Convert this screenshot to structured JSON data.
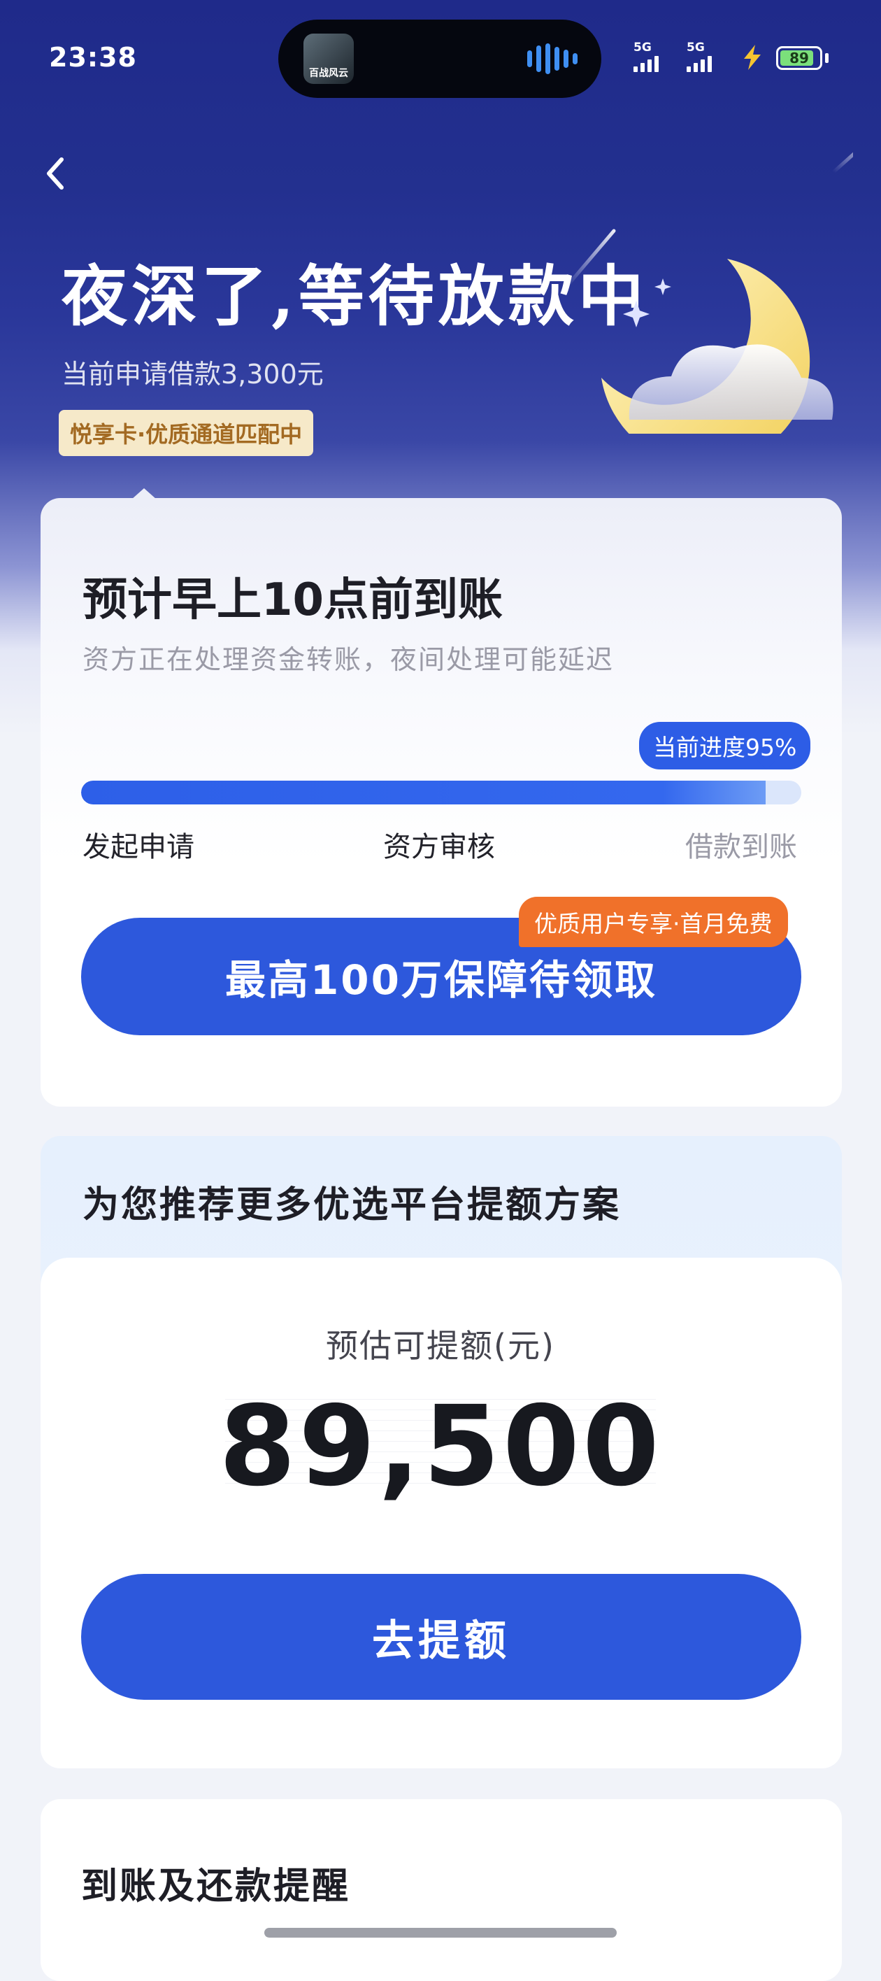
{
  "status_bar": {
    "time": "23:38",
    "island_app_text": "百战风云",
    "signal_1": "5G",
    "signal_2": "5G",
    "battery": "89",
    "battery_level": 0.89
  },
  "header": {
    "back_icon": "chevron-left-icon",
    "title": "夜深了,等待放款中",
    "subtitle": "当前申请借款3,300元",
    "tag": "悦享卡·优质通道匹配中",
    "illustration": "moon-cloud-icon"
  },
  "arrival_card": {
    "title": "预计早上10点前到账",
    "subtitle": "资方正在处理资金转账，夜间处理可能延迟",
    "progress_label": "当前进度95%",
    "progress_value": 0.95,
    "steps": [
      "发起申请",
      "资方审核",
      "借款到账"
    ],
    "cta_label": "最高100万保障待领取",
    "cta_badge": "优质用户专享·首月免费"
  },
  "recommend_card": {
    "title": "为您推荐更多优选平台提额方案",
    "amount_label": "预估可提额(元)",
    "amount": "89,500",
    "cta_label": "去提额"
  },
  "reminder_card": {
    "title": "到账及还款提醒"
  },
  "colors": {
    "primary": "#2d58dc",
    "badge_orange": "#f0712a",
    "night_blue": "#1f2a8a",
    "tag_bg": "#f6e9c9"
  }
}
